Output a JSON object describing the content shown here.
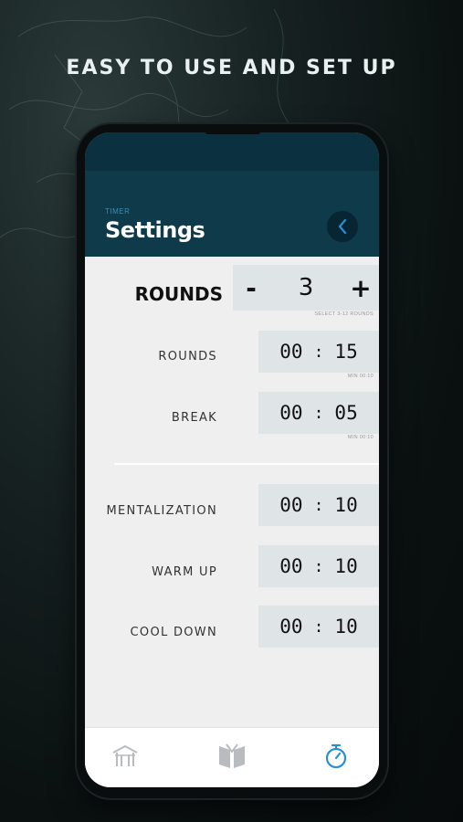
{
  "headline": "EASY TO USE AND SET UP",
  "header": {
    "overline": "TIMER",
    "title": "Settings"
  },
  "rounds_counter": {
    "label": "ROUNDS",
    "minus_label": "-",
    "value": "3",
    "plus_label": "+",
    "hint": "SELECT 3-12 ROUNDS"
  },
  "timers": [
    {
      "label": "ROUNDS",
      "min": "00",
      "sec": "15",
      "hint": "MIN 00:10"
    },
    {
      "label": "BREAK",
      "min": "00",
      "sec": "05",
      "hint": "MIN 00:10"
    },
    {
      "label": "MENTALIZATION",
      "min": "00",
      "sec": "10"
    },
    {
      "label": "WARM UP",
      "min": "00",
      "sec": "10"
    },
    {
      "label": "COOL DOWN",
      "min": "00",
      "sec": "10"
    }
  ],
  "time_separator": ":",
  "tabs": [
    {
      "icon": "dojo-icon",
      "active": false
    },
    {
      "icon": "book-icon",
      "active": false
    },
    {
      "icon": "stopwatch-icon",
      "active": true
    }
  ],
  "colors": {
    "header": "#0e3a4a",
    "accent": "#2a8fcf",
    "field": "#dfe4e7"
  }
}
